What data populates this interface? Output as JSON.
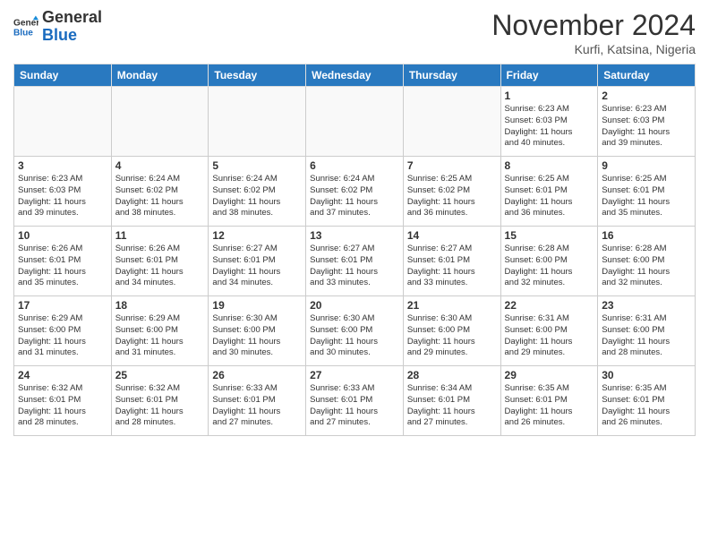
{
  "header": {
    "logo_line1": "General",
    "logo_line2": "Blue",
    "month": "November 2024",
    "location": "Kurfi, Katsina, Nigeria"
  },
  "days_of_week": [
    "Sunday",
    "Monday",
    "Tuesday",
    "Wednesday",
    "Thursday",
    "Friday",
    "Saturday"
  ],
  "weeks": [
    [
      {
        "day": "",
        "info": ""
      },
      {
        "day": "",
        "info": ""
      },
      {
        "day": "",
        "info": ""
      },
      {
        "day": "",
        "info": ""
      },
      {
        "day": "",
        "info": ""
      },
      {
        "day": "1",
        "info": "Sunrise: 6:23 AM\nSunset: 6:03 PM\nDaylight: 11 hours\nand 40 minutes."
      },
      {
        "day": "2",
        "info": "Sunrise: 6:23 AM\nSunset: 6:03 PM\nDaylight: 11 hours\nand 39 minutes."
      }
    ],
    [
      {
        "day": "3",
        "info": "Sunrise: 6:23 AM\nSunset: 6:03 PM\nDaylight: 11 hours\nand 39 minutes."
      },
      {
        "day": "4",
        "info": "Sunrise: 6:24 AM\nSunset: 6:02 PM\nDaylight: 11 hours\nand 38 minutes."
      },
      {
        "day": "5",
        "info": "Sunrise: 6:24 AM\nSunset: 6:02 PM\nDaylight: 11 hours\nand 38 minutes."
      },
      {
        "day": "6",
        "info": "Sunrise: 6:24 AM\nSunset: 6:02 PM\nDaylight: 11 hours\nand 37 minutes."
      },
      {
        "day": "7",
        "info": "Sunrise: 6:25 AM\nSunset: 6:02 PM\nDaylight: 11 hours\nand 36 minutes."
      },
      {
        "day": "8",
        "info": "Sunrise: 6:25 AM\nSunset: 6:01 PM\nDaylight: 11 hours\nand 36 minutes."
      },
      {
        "day": "9",
        "info": "Sunrise: 6:25 AM\nSunset: 6:01 PM\nDaylight: 11 hours\nand 35 minutes."
      }
    ],
    [
      {
        "day": "10",
        "info": "Sunrise: 6:26 AM\nSunset: 6:01 PM\nDaylight: 11 hours\nand 35 minutes."
      },
      {
        "day": "11",
        "info": "Sunrise: 6:26 AM\nSunset: 6:01 PM\nDaylight: 11 hours\nand 34 minutes."
      },
      {
        "day": "12",
        "info": "Sunrise: 6:27 AM\nSunset: 6:01 PM\nDaylight: 11 hours\nand 34 minutes."
      },
      {
        "day": "13",
        "info": "Sunrise: 6:27 AM\nSunset: 6:01 PM\nDaylight: 11 hours\nand 33 minutes."
      },
      {
        "day": "14",
        "info": "Sunrise: 6:27 AM\nSunset: 6:01 PM\nDaylight: 11 hours\nand 33 minutes."
      },
      {
        "day": "15",
        "info": "Sunrise: 6:28 AM\nSunset: 6:00 PM\nDaylight: 11 hours\nand 32 minutes."
      },
      {
        "day": "16",
        "info": "Sunrise: 6:28 AM\nSunset: 6:00 PM\nDaylight: 11 hours\nand 32 minutes."
      }
    ],
    [
      {
        "day": "17",
        "info": "Sunrise: 6:29 AM\nSunset: 6:00 PM\nDaylight: 11 hours\nand 31 minutes."
      },
      {
        "day": "18",
        "info": "Sunrise: 6:29 AM\nSunset: 6:00 PM\nDaylight: 11 hours\nand 31 minutes."
      },
      {
        "day": "19",
        "info": "Sunrise: 6:30 AM\nSunset: 6:00 PM\nDaylight: 11 hours\nand 30 minutes."
      },
      {
        "day": "20",
        "info": "Sunrise: 6:30 AM\nSunset: 6:00 PM\nDaylight: 11 hours\nand 30 minutes."
      },
      {
        "day": "21",
        "info": "Sunrise: 6:30 AM\nSunset: 6:00 PM\nDaylight: 11 hours\nand 29 minutes."
      },
      {
        "day": "22",
        "info": "Sunrise: 6:31 AM\nSunset: 6:00 PM\nDaylight: 11 hours\nand 29 minutes."
      },
      {
        "day": "23",
        "info": "Sunrise: 6:31 AM\nSunset: 6:00 PM\nDaylight: 11 hours\nand 28 minutes."
      }
    ],
    [
      {
        "day": "24",
        "info": "Sunrise: 6:32 AM\nSunset: 6:01 PM\nDaylight: 11 hours\nand 28 minutes."
      },
      {
        "day": "25",
        "info": "Sunrise: 6:32 AM\nSunset: 6:01 PM\nDaylight: 11 hours\nand 28 minutes."
      },
      {
        "day": "26",
        "info": "Sunrise: 6:33 AM\nSunset: 6:01 PM\nDaylight: 11 hours\nand 27 minutes."
      },
      {
        "day": "27",
        "info": "Sunrise: 6:33 AM\nSunset: 6:01 PM\nDaylight: 11 hours\nand 27 minutes."
      },
      {
        "day": "28",
        "info": "Sunrise: 6:34 AM\nSunset: 6:01 PM\nDaylight: 11 hours\nand 27 minutes."
      },
      {
        "day": "29",
        "info": "Sunrise: 6:35 AM\nSunset: 6:01 PM\nDaylight: 11 hours\nand 26 minutes."
      },
      {
        "day": "30",
        "info": "Sunrise: 6:35 AM\nSunset: 6:01 PM\nDaylight: 11 hours\nand 26 minutes."
      }
    ]
  ]
}
